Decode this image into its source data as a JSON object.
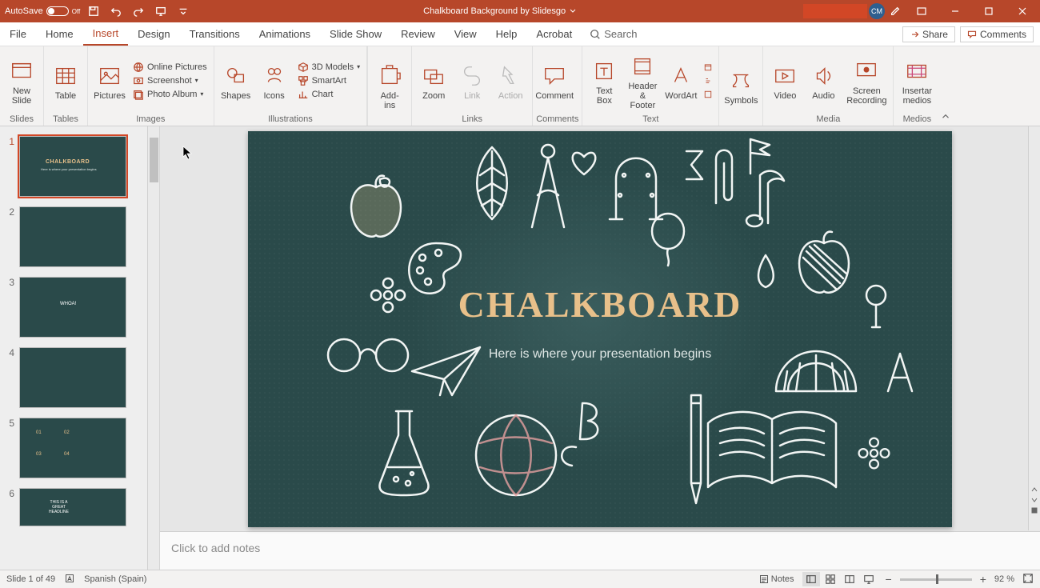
{
  "title_bar": {
    "autosave_label": "AutoSave",
    "autosave_state": "Off",
    "doc_title": "Chalkboard Background by Slidesgo",
    "user_initials": "CM"
  },
  "tabs": {
    "items": [
      "File",
      "Home",
      "Insert",
      "Design",
      "Transitions",
      "Animations",
      "Slide Show",
      "Review",
      "View",
      "Help",
      "Acrobat"
    ],
    "active_index": 2,
    "search_label": "Search",
    "share_label": "Share",
    "comments_label": "Comments"
  },
  "ribbon": {
    "groups": {
      "slides": {
        "label": "Slides",
        "new_slide": "New\nSlide"
      },
      "tables": {
        "label": "Tables",
        "table": "Table"
      },
      "images": {
        "label": "Images",
        "pictures": "Pictures",
        "online_pictures": "Online Pictures",
        "screenshot": "Screenshot",
        "photo_album": "Photo Album"
      },
      "illustrations": {
        "label": "Illustrations",
        "shapes": "Shapes",
        "icons": "Icons",
        "models": "3D Models",
        "smartart": "SmartArt",
        "chart": "Chart"
      },
      "addins": {
        "label": "",
        "addins": "Add-\nins"
      },
      "links": {
        "label": "Links",
        "zoom": "Zoom",
        "link": "Link",
        "action": "Action"
      },
      "comments": {
        "label": "Comments",
        "comment": "Comment"
      },
      "text": {
        "label": "Text",
        "text_box": "Text\nBox",
        "header_footer": "Header\n& Footer",
        "wordart": "WordArt"
      },
      "symbols": {
        "label": "",
        "symbols": "Symbols"
      },
      "media": {
        "label": "Media",
        "video": "Video",
        "audio": "Audio",
        "screen_rec": "Screen\nRecording"
      },
      "medios": {
        "label": "Medios",
        "insertar": "Insertar\nmedios"
      }
    }
  },
  "thumbnails": {
    "selected_index": 0,
    "items": [
      1,
      2,
      3,
      4,
      5,
      6
    ]
  },
  "slide": {
    "title": "CHALKBOARD",
    "subtitle": "Here is where your presentation begins"
  },
  "notes_placeholder": "Click to add notes",
  "status": {
    "slide_of": "Slide 1 of 49",
    "language": "Spanish (Spain)",
    "notes_label": "Notes",
    "zoom_pct": "92 %"
  }
}
